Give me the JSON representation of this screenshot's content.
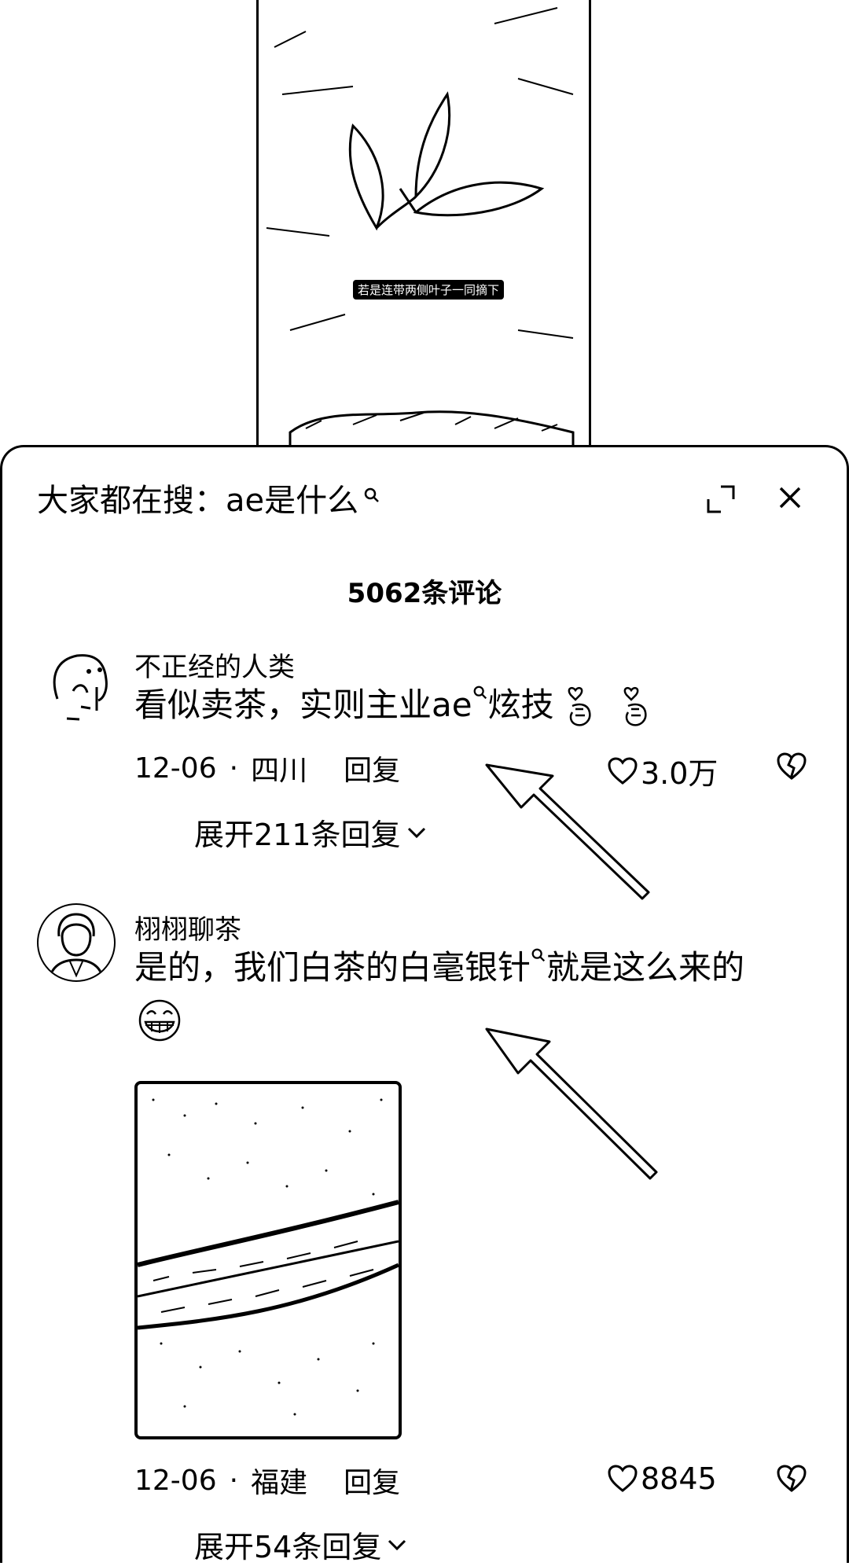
{
  "video": {
    "caption": "若是连带两侧叶子一同摘下"
  },
  "sheet": {
    "search_hint": "大家都在搜：ae是什么",
    "comment_count": "5062条评论"
  },
  "comments": [
    {
      "username": "不正经的人类",
      "text_before": "看似卖茶，实则主业ae",
      "text_after": "炫技",
      "date": "12-06",
      "location": "四川",
      "reply_label": "回复",
      "likes": "3.0万",
      "expand_label": "展开211条回复"
    },
    {
      "username": "栩栩聊茶",
      "text_before": "是的，我们白茶的白毫银针",
      "text_after": "就是这么来的",
      "date": "12-06",
      "location": "福建",
      "reply_label": "回复",
      "likes": "8845",
      "expand_label": "展开54条回复"
    }
  ],
  "icons": {
    "search": "search-icon",
    "expand": "expand-icon",
    "close": "close-icon",
    "like": "heart-outline-icon",
    "dislike": "broken-heart-icon",
    "chevron": "chevron-down-icon",
    "finger_heart": "finger-heart-emoji",
    "grin": "grinning-face-emoji"
  }
}
